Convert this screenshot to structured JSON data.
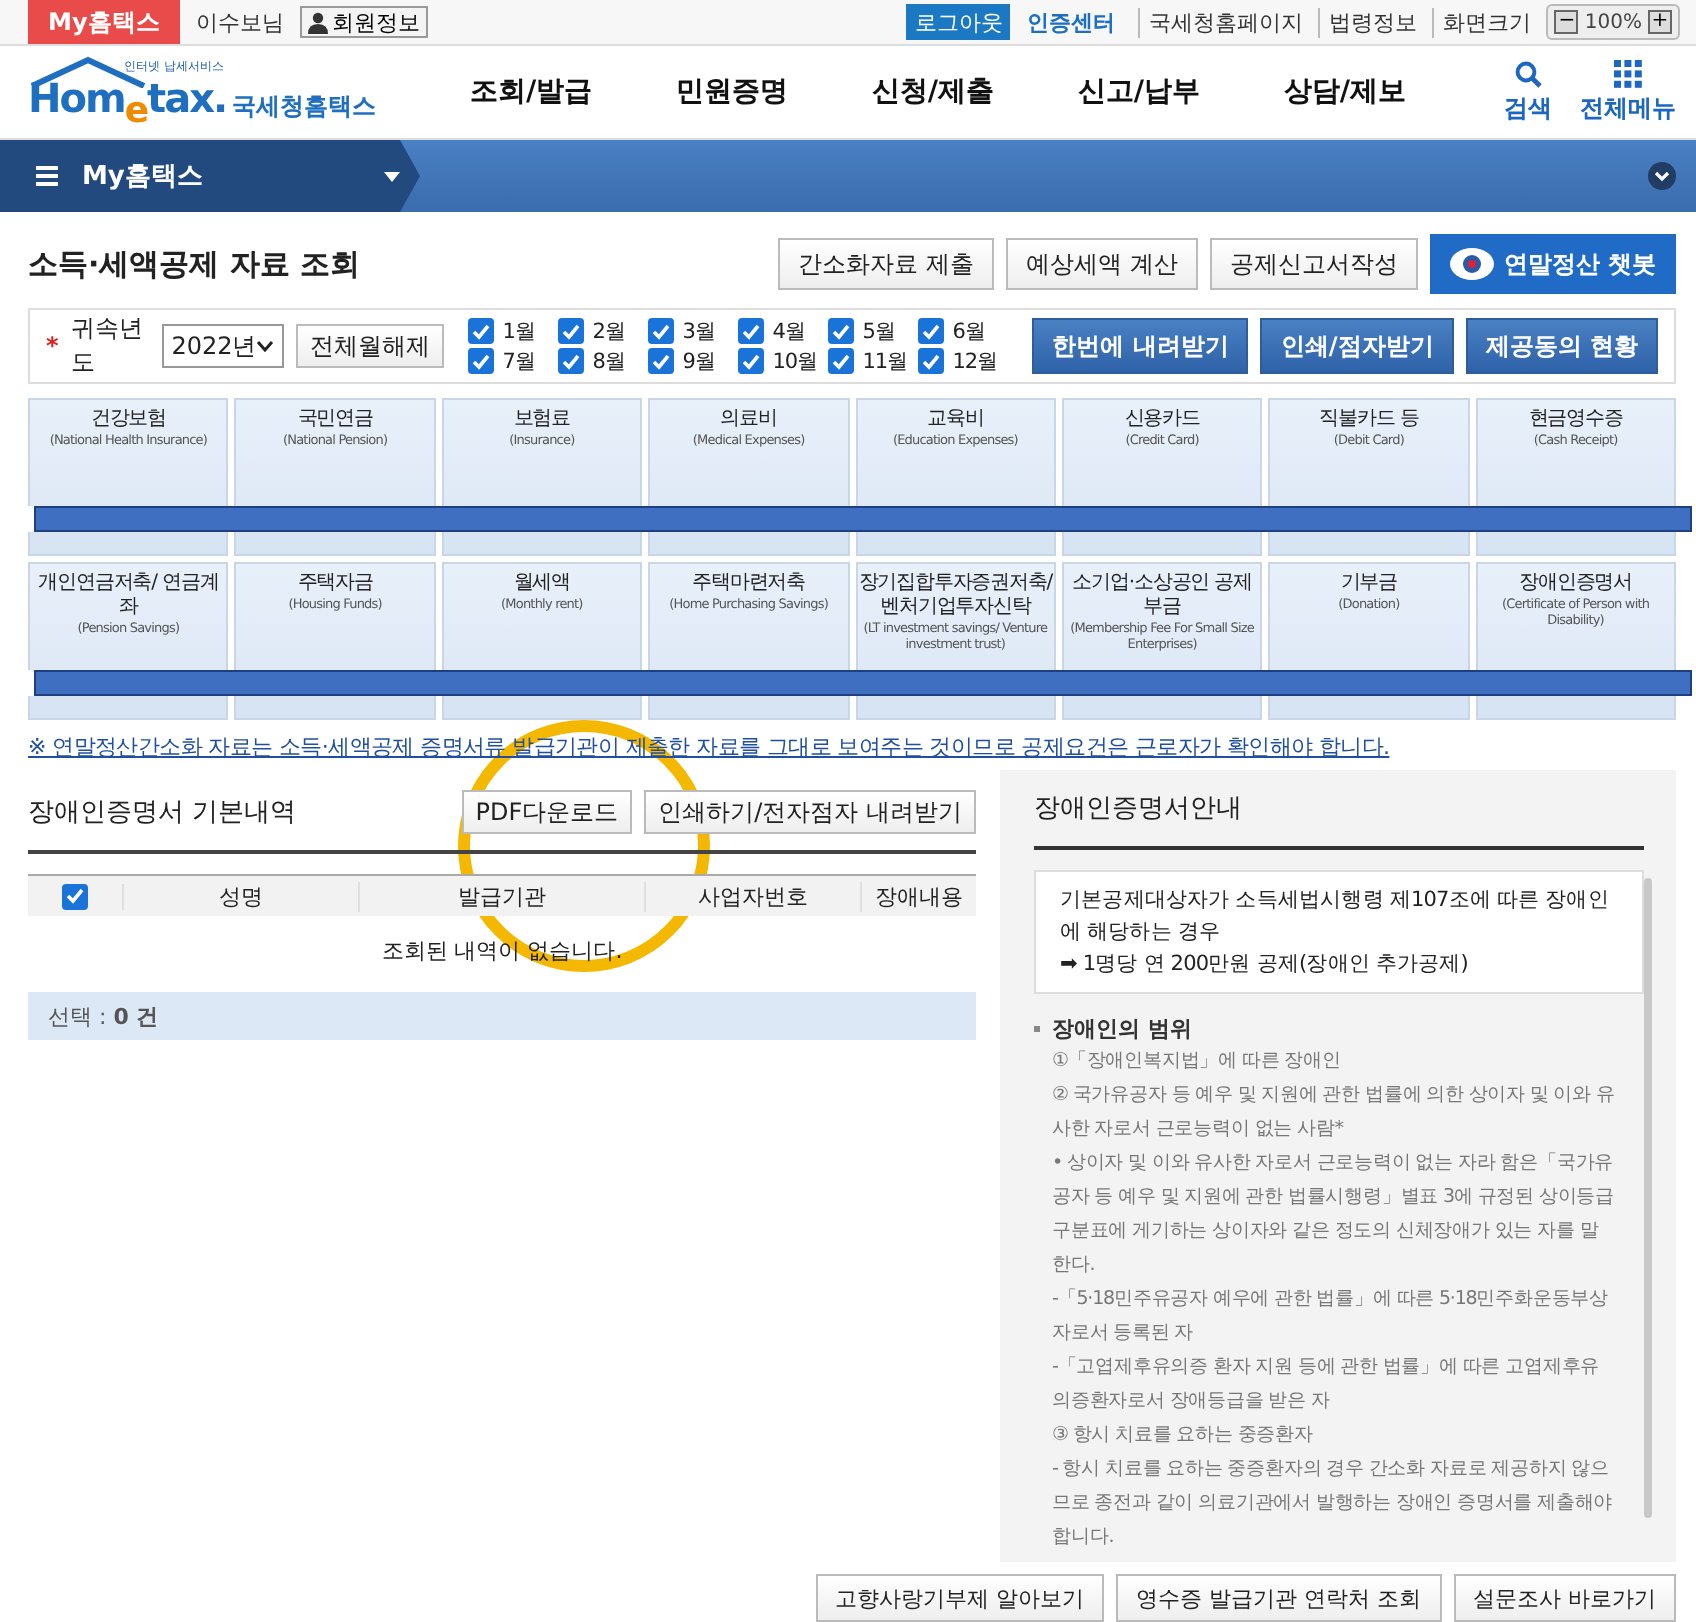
{
  "topbar": {
    "my_button": "My홈택스",
    "user": "이수보님",
    "member_button": "회원정보",
    "logout": "로그아웃",
    "cert": "인증센터",
    "links": [
      "국세청홈페이지",
      "법령정보",
      "화면크기"
    ],
    "zoom_minus": "−",
    "zoom_value": "100%",
    "zoom_plus": "+"
  },
  "header": {
    "logo_tagline": "인터넷 납세서비스",
    "logo": "Hom$_{e}$tax.",
    "logo_kr": "국세청홈택스",
    "menu": [
      "조회/발급",
      "민원증명",
      "신청/제출",
      "신고/납부",
      "상담/제보"
    ],
    "search": "검색",
    "all_menu": "전체메뉴"
  },
  "navbar": {
    "title": "My홈택스"
  },
  "page_title": "소득·세액공제 자료 조회",
  "title_buttons": [
    {
      "label": "간소화자료 제출",
      "kind": "plain"
    },
    {
      "label": "예상세액 계산",
      "kind": "plain"
    },
    {
      "label": "공제신고서작성",
      "kind": "plain"
    },
    {
      "label": "연말정산 챗봇",
      "kind": "chatbot"
    }
  ],
  "filter": {
    "required_mark": "*",
    "label": "귀속년도",
    "year": "2022년",
    "clear_button": "전체월해제",
    "months": [
      {
        "label": "1월",
        "checked": true
      },
      {
        "label": "2월",
        "checked": true
      },
      {
        "label": "3월",
        "checked": true
      },
      {
        "label": "4월",
        "checked": true
      },
      {
        "label": "5월",
        "checked": true
      },
      {
        "label": "6월",
        "checked": true
      },
      {
        "label": "7월",
        "checked": true
      },
      {
        "label": "8월",
        "checked": true
      },
      {
        "label": "9월",
        "checked": true
      },
      {
        "label": "10월",
        "checked": true
      },
      {
        "label": "11월",
        "checked": true
      },
      {
        "label": "12월",
        "checked": true
      }
    ],
    "buttons": [
      "한번에 내려받기",
      "인쇄/점자받기",
      "제공동의 현황"
    ]
  },
  "tiles": [
    [
      {
        "name": "건강보험",
        "en": "(National Health Insurance)"
      },
      {
        "name": "국민연금",
        "en": "(National Pension)"
      },
      {
        "name": "보험료",
        "en": "(Insurance)"
      },
      {
        "name": "의료비",
        "en": "(Medical Expenses)"
      },
      {
        "name": "교육비",
        "en": "(Education Expenses)"
      },
      {
        "name": "신용카드",
        "en": "(Credit Card)"
      },
      {
        "name": "직불카드 등",
        "en": "(Debit Card)"
      },
      {
        "name": "현금영수증",
        "en": "(Cash Receipt)"
      }
    ],
    [
      {
        "name": "개인연금저축/ 연금계좌",
        "en": "(Pension Savings)"
      },
      {
        "name": "주택자금",
        "en": "(Housing Funds)"
      },
      {
        "name": "월세액",
        "en": "(Monthly rent)"
      },
      {
        "name": "주택마련저축",
        "en": "(Home Purchasing Savings)"
      },
      {
        "name": "장기집합투자증권저축/ 벤처기업투자신탁",
        "en": "(LT investment savings/ Venture investment trust)"
      },
      {
        "name": "소기업·소상공인 공제부금",
        "en": "(Membership Fee For Small Size Enterprises)"
      },
      {
        "name": "기부금",
        "en": "(Donation)"
      },
      {
        "name": "장애인증명서",
        "en": "(Certificate of Person with Disability)"
      }
    ]
  ],
  "notice": "※ 연말정산간소화 자료는 소득·세액공제 증명서류 발급기관이 제출한 자료를 그대로 보여주는 것이므로 공제요건은 근로자가 확인해야 합니다.",
  "basic": {
    "title": "장애인증명서 기본내역",
    "buttons": [
      "PDF다운로드",
      "인쇄하기/전자점자 내려받기"
    ],
    "all_checked": true,
    "columns": [
      "성명",
      "발급기관",
      "사업자번호",
      "장애내용"
    ],
    "empty": "조회된 내역이 없습니다.",
    "selection": "선택 : **0 건**"
  },
  "guide": {
    "title": "장애인증명서안내",
    "box": [
      "기본공제대상자가 소득세법시행령 제107조에 따른 장애인에 해당하는 경우",
      "➡ 1명당 연 200만원 공제(장애인 추가공제)"
    ],
    "section": "장애인의 범위",
    "lines": [
      "①「장애인복지법」에 따른 장애인",
      "② 국가유공자 등 예우 및 지원에 관한 법률에 의한 상이자 및 이와 유사한 자로서 근로능력이 없는 사람*",
      "• 상이자 및 이와 유사한 자로서 근로능력이 없는 자라 함은「국가유공자 등 예우 및 지원에 관한 법률시행령」별표 3에 규정된 상이등급 구분표에 게기하는 상이자와 같은 정도의 신체장애가 있는 자를 말한다.",
      "-「5·18민주유공자 예우에 관한 법률」에 따른 5·18민주화운동부상자로서 등록된 자",
      "-「고엽제후유의증 환자 지원 등에 관한 법률」에 따른 고엽제후유의증환자로서 장애등급을 받은 자",
      "③ 항시 치료를 요하는 중증환자",
      "- 항시 치료를 요하는 중증환자의 경우 간소화 자료로 제공하지 않으므로 종전과 같이 의료기관에서 발행하는 장애인 증명서를 제출해야 합니다."
    ]
  },
  "bottom_buttons": [
    "고향사랑기부제 알아보기",
    "영수증 발급기관 연락처 조회",
    "설문조사 바로가기"
  ]
}
